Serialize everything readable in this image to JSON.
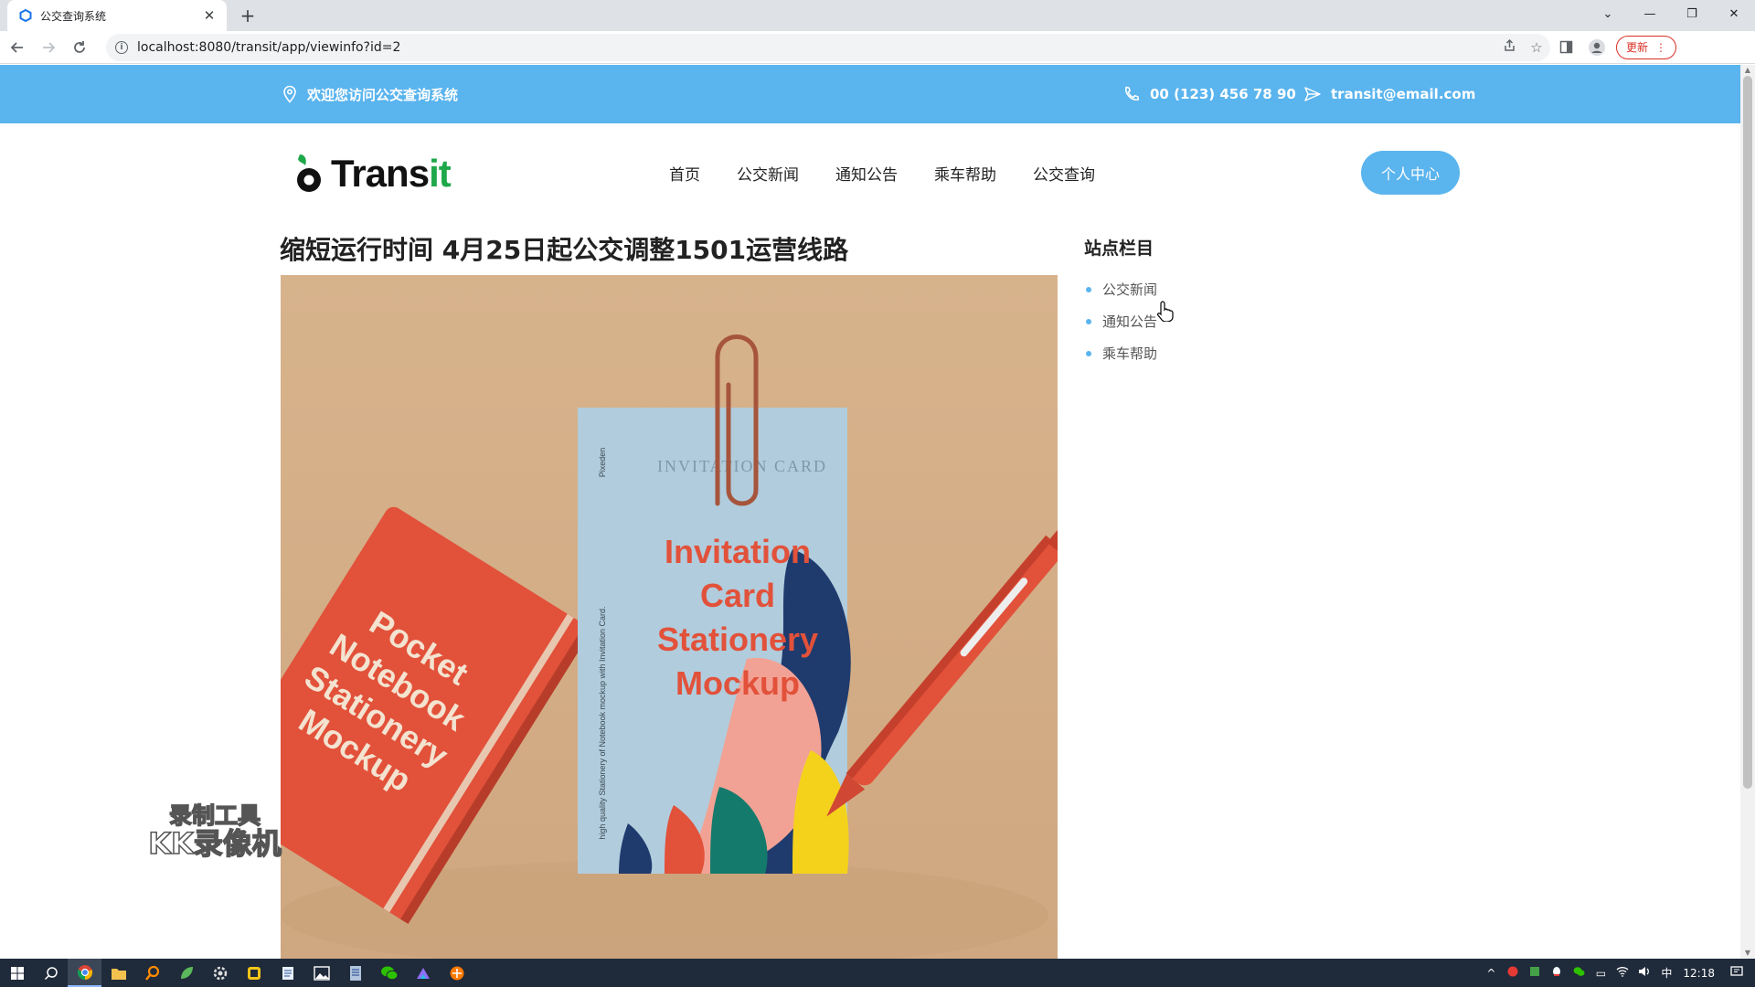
{
  "browser": {
    "tab_title": "公交查询系统",
    "tab_close": "✕",
    "new_tab": "+",
    "url": "localhost:8080/transit/app/viewinfo?id=2",
    "update_label": "更新",
    "window_controls": [
      "⌄",
      "—",
      "❐",
      "✕"
    ]
  },
  "topbar": {
    "welcome": "欢迎您访问公交查询系统",
    "phone": "00 (123) 456 78 90",
    "email": "transit@email.com"
  },
  "header": {
    "logo_prefix": "Trans",
    "logo_suffix": "it",
    "nav": [
      "首页",
      "公交新闻",
      "通知公告",
      "乘车帮助",
      "公交查询"
    ],
    "user_center": "个人中心"
  },
  "article": {
    "title": "缩短运行时间 4月25日起公交调整1501运营线路",
    "image": {
      "card_line1": "Invitation",
      "card_line2": "Card",
      "card_line3": "Stationery",
      "card_line4": "Mockup",
      "card_header": "INVITATION CARD",
      "card_brand": "Pixeden",
      "card_side_text": "high quality Stationery of Notebook mockup with Invitation Card.",
      "notebook_line1": "Pocket",
      "notebook_line2": "Notebook",
      "notebook_line3": "Stationery",
      "notebook_line4": "Mockup"
    }
  },
  "sidebar": {
    "title": "站点栏目",
    "items": [
      "公交新闻",
      "通知公告",
      "乘车帮助"
    ]
  },
  "watermark": {
    "line1": "录制工具",
    "line2": "KK录像机"
  },
  "taskbar": {
    "time": "12:18",
    "ime": "中"
  },
  "colors": {
    "accent": "#5ab4ee",
    "logo_green": "#1fa84a",
    "notebook_red": "#e2513a",
    "card_blue": "#b7d3e4",
    "image_bg": "#d9b58f"
  }
}
